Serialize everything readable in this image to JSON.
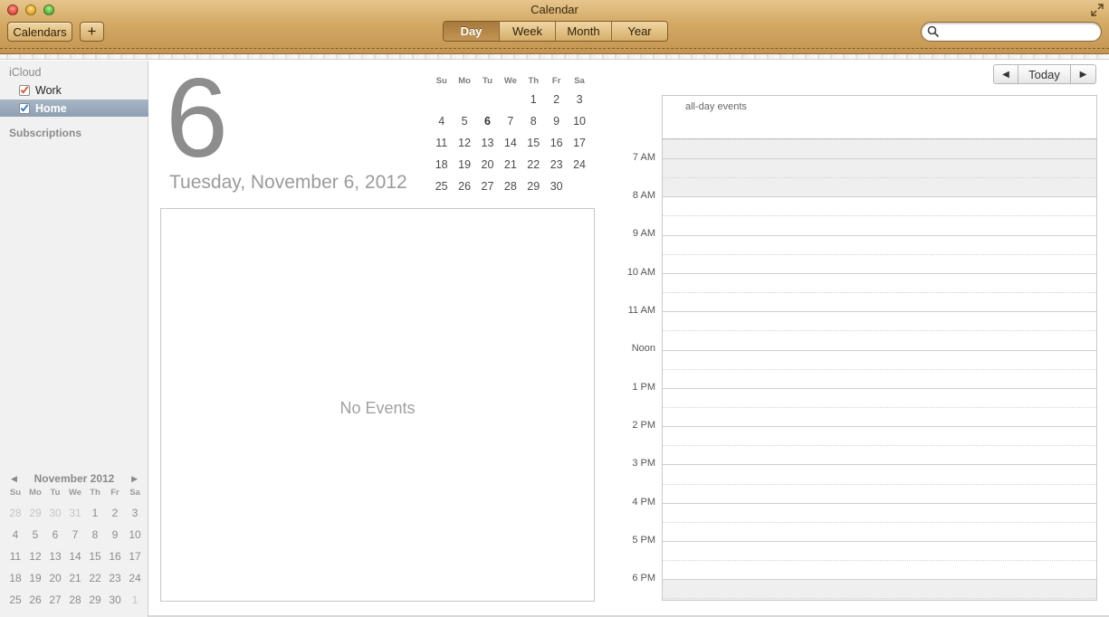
{
  "window": {
    "title": "Calendar"
  },
  "toolbar": {
    "calendars_label": "Calendars",
    "add_label": "+",
    "views": [
      "Day",
      "Week",
      "Month",
      "Year"
    ],
    "active_view": "Day",
    "search_placeholder": "",
    "search_value": ""
  },
  "sidebar": {
    "section_icloud": "iCloud",
    "calendars": [
      {
        "label": "Work",
        "checked": true,
        "color": "#d9532c"
      },
      {
        "label": "Home",
        "checked": true,
        "color": "#2a73c8"
      }
    ],
    "section_subscriptions": "Subscriptions"
  },
  "mini_calendar": {
    "title": "November 2012",
    "prev_icon": "triangle-left-icon",
    "next_icon": "triangle-right-icon",
    "dow": [
      "Su",
      "Mo",
      "Tu",
      "We",
      "Th",
      "Fr",
      "Sa"
    ],
    "weeks": [
      [
        "28",
        "29",
        "30",
        "31",
        "1",
        "2",
        "3"
      ],
      [
        "4",
        "5",
        "6",
        "7",
        "8",
        "9",
        "10"
      ],
      [
        "11",
        "12",
        "13",
        "14",
        "15",
        "16",
        "17"
      ],
      [
        "18",
        "19",
        "20",
        "21",
        "22",
        "23",
        "24"
      ],
      [
        "25",
        "26",
        "27",
        "28",
        "29",
        "30",
        "1"
      ]
    ]
  },
  "day_view": {
    "day_number": "6",
    "long_date": "Tuesday, November 6, 2012",
    "no_events": "No Events",
    "month_dow": [
      "Su",
      "Mo",
      "Tu",
      "We",
      "Th",
      "Fr",
      "Sa"
    ],
    "month_weeks": [
      [
        "",
        "",
        "",
        "",
        "1",
        "2",
        "3"
      ],
      [
        "4",
        "5",
        "6",
        "7",
        "8",
        "9",
        "10"
      ],
      [
        "11",
        "12",
        "13",
        "14",
        "15",
        "16",
        "17"
      ],
      [
        "18",
        "19",
        "20",
        "21",
        "22",
        "23",
        "24"
      ],
      [
        "25",
        "26",
        "27",
        "28",
        "29",
        "30",
        ""
      ]
    ],
    "today": "6"
  },
  "time_grid": {
    "nav_prev_icon": "triangle-left-icon",
    "today_label": "Today",
    "nav_next_icon": "triangle-right-icon",
    "all_day_label": "all-day events",
    "hours": [
      "7 AM",
      "8 AM",
      "9 AM",
      "10 AM",
      "11 AM",
      "Noon",
      "1 PM",
      "2 PM",
      "3 PM",
      "4 PM",
      "5 PM",
      "6 PM"
    ]
  }
}
